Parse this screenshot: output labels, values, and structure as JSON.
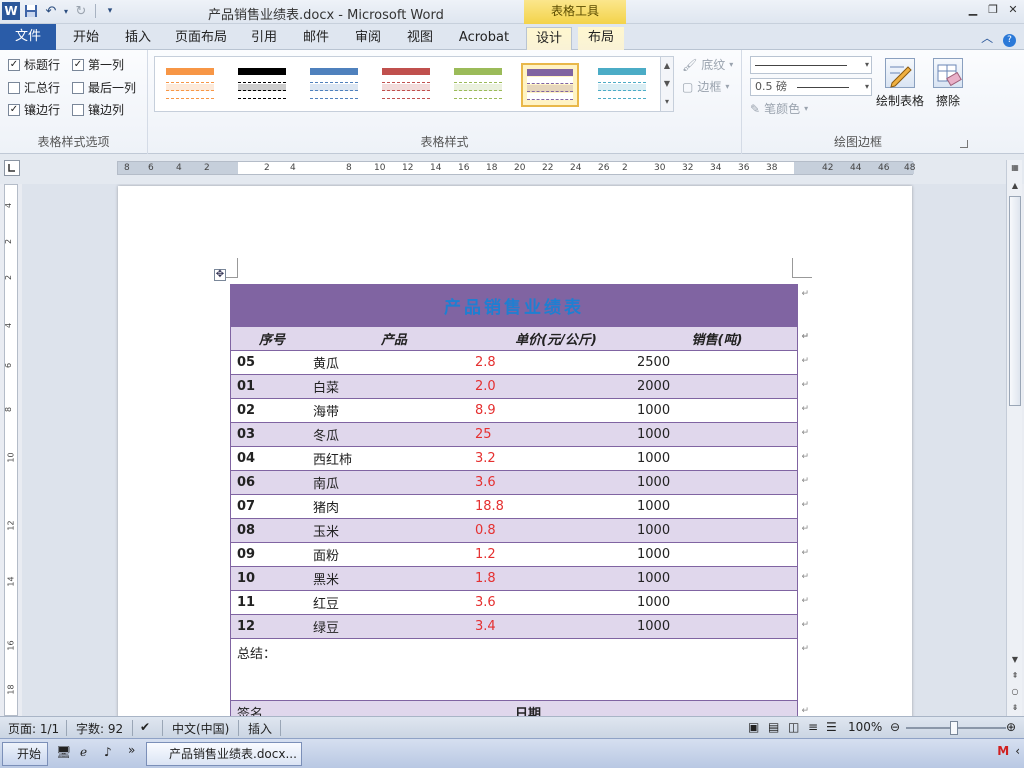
{
  "titlebar": {
    "title": "产品销售业绩表.docx - Microsoft Word",
    "context_tool": "表格工具",
    "logo": "W"
  },
  "tabs": [
    "文件",
    "开始",
    "插入",
    "页面布局",
    "引用",
    "邮件",
    "审阅",
    "视图",
    "Acrobat",
    "设计",
    "布局"
  ],
  "active_tab": "设计",
  "ribbon": {
    "style_options": {
      "label": "表格样式选项",
      "options": [
        {
          "label": "标题行",
          "checked": true
        },
        {
          "label": "第一列",
          "checked": true
        },
        {
          "label": "汇总行",
          "checked": false
        },
        {
          "label": "最后一列",
          "checked": false
        },
        {
          "label": "镶边行",
          "checked": true
        },
        {
          "label": "镶边列",
          "checked": false
        }
      ]
    },
    "table_styles": {
      "label": "表格样式",
      "shading": "底纹",
      "borders": "边框",
      "swatches": [
        "#f79646",
        "#000000",
        "#4f81bd",
        "#c0504d",
        "#9bbb59",
        "#8064a2",
        "#4bacc6"
      ],
      "selected_index": 5
    },
    "draw_borders": {
      "label": "绘图边框",
      "weight": "0.5 磅",
      "pen_color": "笔颜色",
      "draw_table": "绘制表格",
      "eraser": "擦除"
    }
  },
  "ruler": {
    "labels": [
      "8",
      "6",
      "4",
      "2",
      "2",
      "4",
      "8",
      "10",
      "12",
      "14",
      "16",
      "18",
      "20",
      "22",
      "24",
      "26",
      "2",
      "30",
      "32",
      "34",
      "36",
      "38",
      "42",
      "44",
      "46",
      "48"
    ]
  },
  "document": {
    "table": {
      "title": "产品销售业绩表",
      "headers": [
        "序号",
        "产品",
        "单价(元/公斤)",
        "销售(吨)"
      ],
      "rows": [
        [
          "05",
          "黄瓜",
          "2.8",
          "2500"
        ],
        [
          "01",
          "白菜",
          "2.0",
          "2000"
        ],
        [
          "02",
          "海带",
          "8.9",
          "1000"
        ],
        [
          "03",
          "冬瓜",
          "25",
          "1000"
        ],
        [
          "04",
          "西红柿",
          "3.2",
          "1000"
        ],
        [
          "06",
          "南瓜",
          "3.6",
          "1000"
        ],
        [
          "07",
          "猪肉",
          "18.8",
          "1000"
        ],
        [
          "08",
          "玉米",
          "0.8",
          "1000"
        ],
        [
          "09",
          "面粉",
          "1.2",
          "1000"
        ],
        [
          "10",
          "黑米",
          "1.8",
          "1000"
        ],
        [
          "11",
          "红豆",
          "3.6",
          "1000"
        ],
        [
          "12",
          "绿豆",
          "3.4",
          "1000"
        ]
      ],
      "summary_label": "总结：",
      "sign_label": "签名",
      "date_label": "日期",
      "price_color": "#e53030",
      "header_color": "#8064a2",
      "band_color": "#e0d7ec",
      "title_color": "#1f7fd1"
    }
  },
  "statusbar": {
    "page": "页面: 1/1",
    "words": "字数: 92",
    "language": "中文(中国)",
    "mode": "插入",
    "zoom": "100%"
  },
  "taskbar": {
    "start": "开始",
    "window": "产品销售业绩表.docx..."
  }
}
